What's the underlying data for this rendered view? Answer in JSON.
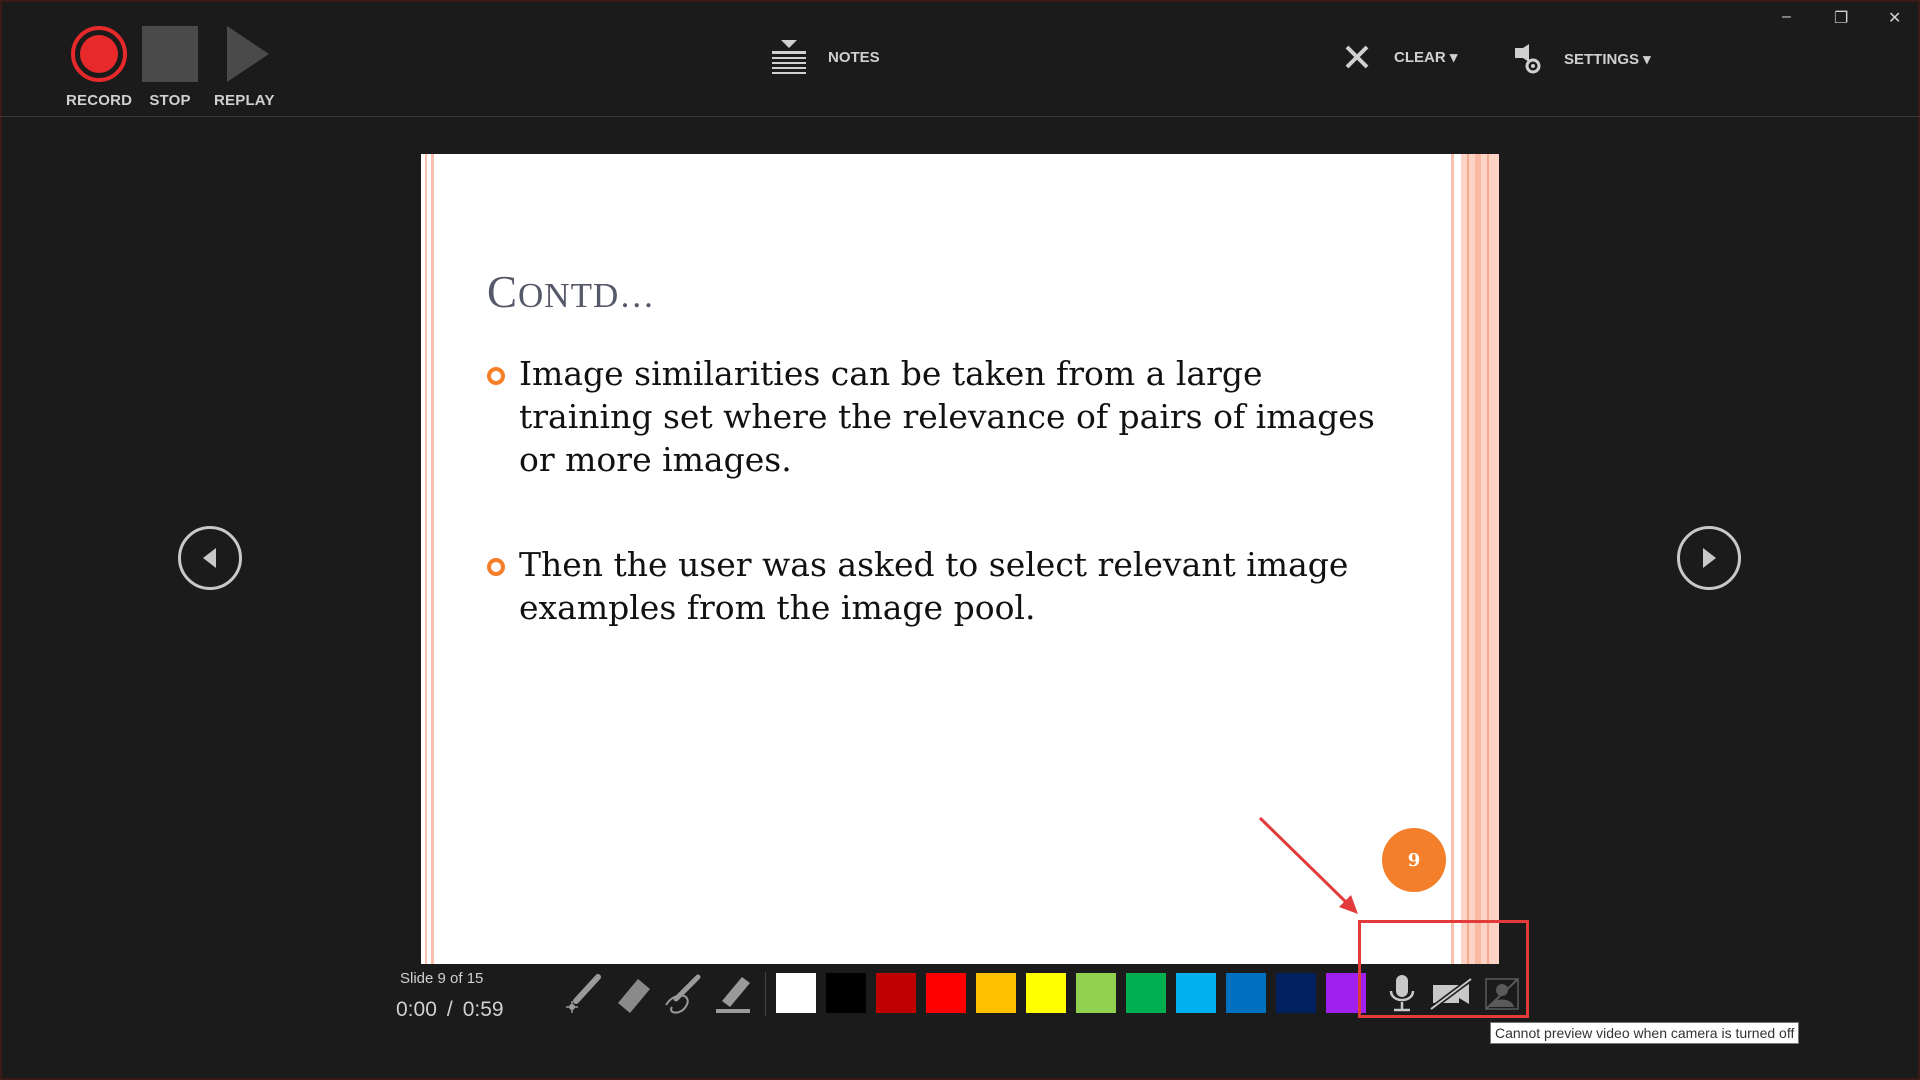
{
  "toolbar": {
    "record_label": "RECORD",
    "stop_label": "STOP",
    "replay_label": "REPLAY",
    "notes_label": "NOTES",
    "clear_label": "CLEAR ▾",
    "settings_label": "SETTINGS ▾"
  },
  "window_controls": {
    "minimize": "–",
    "restore": "❐",
    "close": "✕"
  },
  "slide": {
    "title_cap": "C",
    "title_rest": "ONTD…",
    "bullets": [
      "Image similarities can be taken from a large training set where the relevance of pairs of images or more images.",
      "Then the user was asked to select relevant image examples from the image pool."
    ],
    "number": "9",
    "accent_color": "#f47f2a",
    "stripe_color": "#f9c0ad"
  },
  "footer": {
    "slide_counter": "Slide 9 of 15",
    "elapsed": "0:00",
    "separator": "/",
    "total": "0:59"
  },
  "tools": [
    "laser-pointer-icon",
    "eraser-icon",
    "pen-icon",
    "highlighter-icon"
  ],
  "colors": [
    "#ffffff",
    "#000000",
    "#c00000",
    "#ff0000",
    "#ffc000",
    "#ffff00",
    "#92d050",
    "#00b050",
    "#00b0f0",
    "#0070c0",
    "#002060",
    "#a020f0"
  ],
  "media": {
    "microphone": "microphone-icon",
    "camera": "camera-off-icon",
    "preview": "camera-preview-off-icon"
  },
  "tooltip": "Cannot preview video when camera is turned off"
}
